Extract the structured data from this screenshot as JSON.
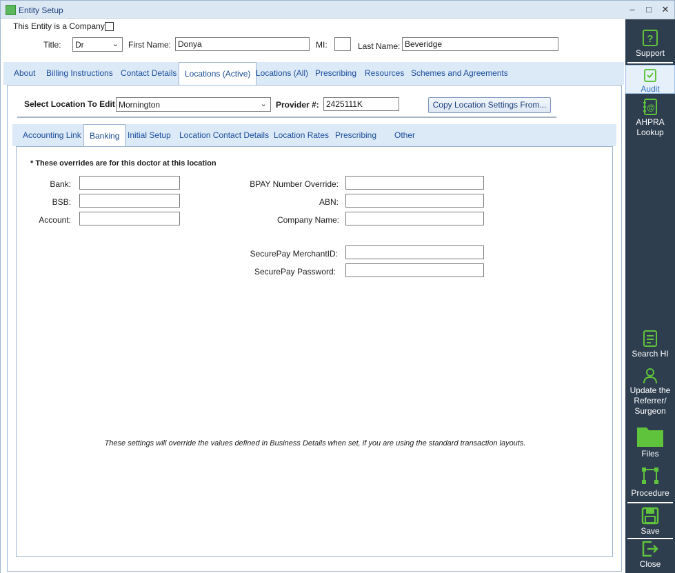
{
  "window": {
    "title": "Entity Setup",
    "controls": {
      "minimize": "–",
      "maximize": "□",
      "close": "✕"
    }
  },
  "header": {
    "company_label": "This Entity is a Company",
    "company_checked": false,
    "title_label": "Title:",
    "title_value": "Dr",
    "first_name_label": "First Name:",
    "first_name_value": "Donya",
    "mi_label": "MI:",
    "mi_value": "",
    "last_name_label": "Last Name:",
    "last_name_value": "Beveridge"
  },
  "main_tabs": [
    {
      "label": "About",
      "active": false
    },
    {
      "label": "Billing Instructions",
      "active": false
    },
    {
      "label": "Contact Details",
      "active": false
    },
    {
      "label": "Locations (Active)",
      "active": true
    },
    {
      "label": "Locations (All)",
      "active": false
    },
    {
      "label": "Prescribing",
      "active": false
    },
    {
      "label": "Resources",
      "active": false
    },
    {
      "label": "Schemes and Agreements",
      "active": false
    }
  ],
  "location": {
    "select_label": "Select Location To Edit:",
    "select_value": "Mornington",
    "provider_label": "Provider #:",
    "provider_value": "2425111K",
    "copy_button": "Copy Location Settings From..."
  },
  "sub_tabs": [
    {
      "label": "Accounting Link",
      "active": false
    },
    {
      "label": "Banking",
      "active": true
    },
    {
      "label": "Initial Setup",
      "active": false
    },
    {
      "label": "Location Contact Details",
      "active": false
    },
    {
      "label": "Location Rates",
      "active": false
    },
    {
      "label": "Prescribing",
      "active": false
    },
    {
      "label": "Other",
      "active": false
    }
  ],
  "banking": {
    "note": "* These overrides are for this doctor at this location",
    "bank_label": "Bank:",
    "bank_value": "",
    "bsb_label": "BSB:",
    "bsb_value": "",
    "account_label": "Account:",
    "account_value": "",
    "bpay_label": "BPAY Number Override:",
    "bpay_value": "",
    "abn_label": "ABN:",
    "abn_value": "",
    "company_name_label": "Company Name:",
    "company_name_value": "",
    "securepay_merchant_label": "SecurePay MerchantID:",
    "securepay_merchant_value": "",
    "securepay_password_label": "SecurePay Password:",
    "securepay_password_value": "",
    "footnote": "These settings will override the values defined in Business Details when set, if you are using the standard transaction layouts."
  },
  "sidebar": {
    "support": "Support",
    "audit": "Audit",
    "ahpra": "AHPRA Lookup",
    "search_hi": "Search HI",
    "update_referrer": "Update the Referrer/ Surgeon",
    "files": "Files",
    "procedure": "Procedure",
    "save": "Save",
    "close": "Close"
  },
  "colors": {
    "accent_green": "#5fc33b",
    "sidebar_bg": "#2e3e4f",
    "tab_text": "#1c4f9c"
  }
}
